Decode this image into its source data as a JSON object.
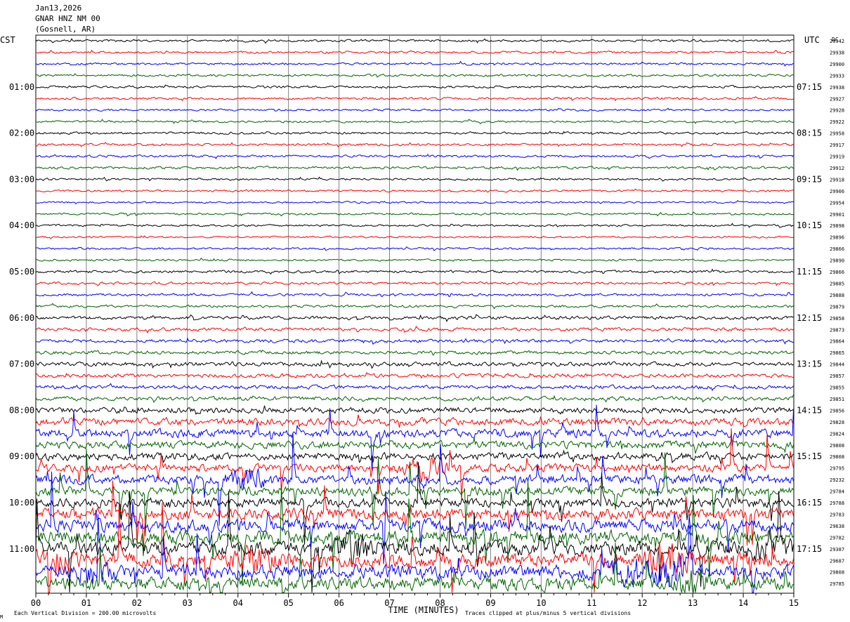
{
  "header": {
    "date": "Jan13,2026",
    "station": "GNAR HNZ NM 00",
    "location": "(Gosnell, AR)"
  },
  "left_axis_title": "CST",
  "right_axis_title": "UTC",
  "dc_label": "DC",
  "footer": {
    "scale_note": "Each Vertical Division =  200.00 microvolts",
    "clip_note": "Traces clipped at plus/minus 5 vertical divisions",
    "corner_mark": "M"
  },
  "colors": {
    "trace_cycle": [
      "#000000",
      "#ff0000",
      "#0000ff",
      "#006400"
    ],
    "grid": "#808080",
    "background": "#ffffff"
  },
  "chart_data": {
    "type": "seismogram",
    "xlabel": "TIME (MINUTES)",
    "xlim": [
      0,
      15
    ],
    "x_ticks": [
      "00",
      "01",
      "02",
      "03",
      "04",
      "05",
      "06",
      "07",
      "08",
      "09",
      "10",
      "11",
      "12",
      "13",
      "14",
      "15"
    ],
    "lines_per_hour": 4,
    "minutes_per_line": 15,
    "left_hour_labels": [
      "01:00",
      "02:00",
      "03:00",
      "04:00",
      "05:00",
      "06:00",
      "07:00",
      "08:00",
      "09:00",
      "10:00",
      "11:00"
    ],
    "right_hour_labels": [
      "07:15",
      "08:15",
      "09:15",
      "10:15",
      "11:15",
      "12:15",
      "13:15",
      "14:15",
      "15:15",
      "16:15",
      "17:15"
    ],
    "dc_offsets": [
      "29942",
      "29938",
      "29900",
      "29933",
      "29938",
      "29927",
      "29928",
      "29922",
      "29958",
      "29917",
      "29919",
      "29912",
      "29918",
      "29906",
      "29954",
      "29901",
      "29898",
      "29896",
      "29866",
      "29890",
      "29866",
      "29885",
      "29888",
      "29879",
      "29858",
      "29873",
      "29864",
      "29865",
      "29844",
      "29857",
      "29855",
      "29851",
      "29856",
      "29828",
      "29824",
      "29808",
      "29808",
      "29795",
      "29232",
      "29784",
      "29788",
      "29783",
      "29638",
      "29782",
      "29387",
      "29687",
      "29808",
      "29785"
    ],
    "activity": [
      0.9,
      0.9,
      0.9,
      0.9,
      0.9,
      0.9,
      0.8,
      0.8,
      0.9,
      0.9,
      0.9,
      1.0,
      0.8,
      0.8,
      0.7,
      0.8,
      0.8,
      0.7,
      0.8,
      0.8,
      1.0,
      1.0,
      1.0,
      1.0,
      1.3,
      1.3,
      1.3,
      1.4,
      1.6,
      1.5,
      1.5,
      1.6,
      2.3,
      2.9,
      3.3,
      3.0,
      3.0,
      3.2,
      3.8,
      3.6,
      3.6,
      4.6,
      4.9,
      5.5,
      5.6,
      5.8,
      5.4,
      5.2
    ],
    "bursts": [
      {
        "line": 37,
        "minute": 7.7,
        "amp": 2.2
      },
      {
        "line": 38,
        "minute": 4.2,
        "amp": 2.0
      },
      {
        "line": 44,
        "minute": 6.3,
        "amp": 2.4
      },
      {
        "line": 44,
        "minute": 14.5,
        "amp": 2.2
      },
      {
        "line": 45,
        "minute": 0.3,
        "amp": 2.6
      },
      {
        "line": 45,
        "minute": 4.3,
        "amp": 2.2
      },
      {
        "line": 45,
        "minute": 12.5,
        "amp": 2.8
      },
      {
        "line": 46,
        "minute": 1.2,
        "amp": 2.0
      },
      {
        "line": 46,
        "minute": 11.7,
        "amp": 2.8
      },
      {
        "line": 46,
        "minute": 12.6,
        "amp": 3.0
      },
      {
        "line": 47,
        "minute": 13.0,
        "amp": 2.4
      }
    ]
  }
}
